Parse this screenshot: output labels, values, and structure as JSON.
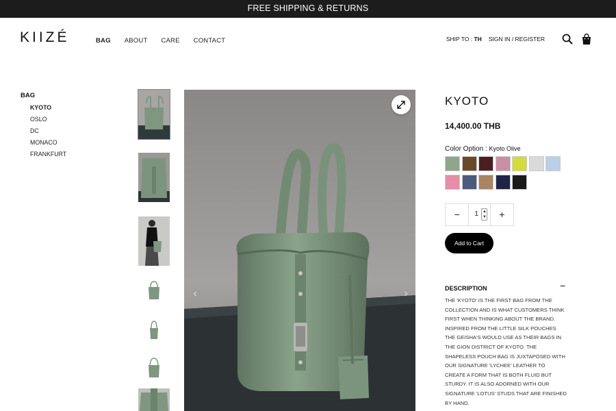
{
  "announcement": "FREE SHIPPING & RETURNS",
  "header": {
    "logo": "KIIZÉ",
    "nav": [
      "BAG",
      "ABOUT",
      "CARE",
      "CONTACT"
    ],
    "ship_to_label": "SHIP TO : ",
    "ship_to_value": "TH",
    "signin": "SIGN IN / REGISTER",
    "icons": [
      "search-icon",
      "shopping-bag-icon"
    ]
  },
  "sidebar": {
    "title": "BAG",
    "items": [
      "KYOTO",
      "OSLO",
      "DC",
      "MONACO",
      "FRANKFURT"
    ],
    "active": "KYOTO"
  },
  "gallery": {
    "thumbnail_count": 7,
    "selected_index": 0,
    "icons": [
      "expand-icon",
      "chevron-left-icon",
      "chevron-right-icon"
    ]
  },
  "product": {
    "title": "KYOTO",
    "price": "14,400.00 THB",
    "color_label": "Color Option : ",
    "color_value": "Kyoto Olive",
    "swatch_colors": [
      "#8ea68b",
      "#6b4a2a",
      "#4a1f24",
      "#c98fa5",
      "#d3dc3a",
      "#dadada",
      "#b9cfea",
      "#e38fa6",
      "#4c5a7e",
      "#a98464",
      "#1f2447",
      "#1a1a1a"
    ],
    "quantity": "1",
    "qty_minus": "−",
    "qty_plus": "+",
    "add_to_cart": "Add to Cart",
    "description_title": "DESCRIPTION",
    "description_toggle": "−",
    "description": "THE 'KYOTO' IS THE FIRST BAG FROM THE COLLECTION AND IS WHAT CUSTOMERS THINK FIRST WHEN THINKING ABOUT THE BRAND. INSPIRED FROM THE LITTLE SILK POUCHES THE GEISHA'S WOULD USE AS THEIR BAGS IN THE GION DISTRICT OF KYOTO. THE SHAPELESS POUCH BAG IS JUXTAPOSED WITH OUR SIGNATURE 'LYCHEE' LEATHER TO CREATE A FORM THAT IS BOTH FLUID BUT STURDY. IT IS ALSO ADORNED WITH OUR SIGNATURE 'LOTUS' STUDS THAT ARE FINISHED BY HAND."
  }
}
